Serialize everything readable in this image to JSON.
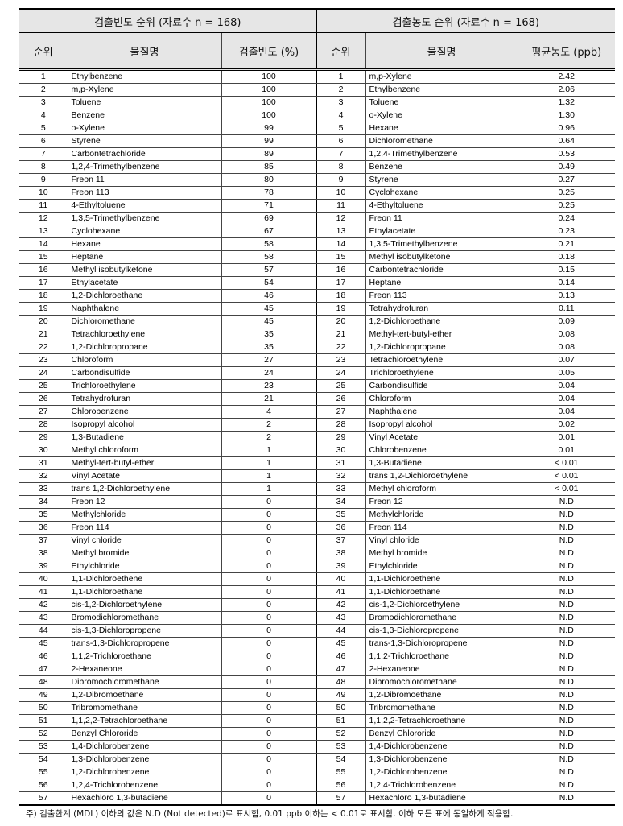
{
  "header": {
    "left_title": "검출빈도 순위 (자료수 n = 168)",
    "right_title": "검출농도 순위 (자료수 n = 168)",
    "col_rank": "순위",
    "col_name": "물질명",
    "col_freq": "검출빈도 (%)",
    "col_rank2": "순위",
    "col_name2": "물질명",
    "col_conc": "평균농도 (ppb)"
  },
  "left_rows": [
    [
      "1",
      "Ethylbenzene",
      "100"
    ],
    [
      "2",
      "m,p-Xylene",
      "100"
    ],
    [
      "3",
      "Toluene",
      "100"
    ],
    [
      "4",
      "Benzene",
      "100"
    ],
    [
      "5",
      "o-Xylene",
      "99"
    ],
    [
      "6",
      "Styrene",
      "99"
    ],
    [
      "7",
      "Carbontetrachloride",
      "89"
    ],
    [
      "8",
      "1,2,4-Trimethylbenzene",
      "85"
    ],
    [
      "9",
      "Freon  11",
      "80"
    ],
    [
      "10",
      "Freon  113",
      "78"
    ],
    [
      "11",
      "4-Ethyltoluene",
      "71"
    ],
    [
      "12",
      "1,3,5-Trimethylbenzene",
      "69"
    ],
    [
      "13",
      "Cyclohexane",
      "67"
    ],
    [
      "14",
      "Hexane",
      "58"
    ],
    [
      "15",
      "Heptane",
      "58"
    ],
    [
      "16",
      "Methyl  isobutylketone",
      "57"
    ],
    [
      "17",
      "Ethylacetate",
      "54"
    ],
    [
      "18",
      "1,2-Dichloroethane",
      "46"
    ],
    [
      "19",
      "Naphthalene",
      "45"
    ],
    [
      "20",
      "Dichloromethane",
      "45"
    ],
    [
      "21",
      "Tetrachloroethylene",
      "35"
    ],
    [
      "22",
      "1,2-Dichloropropane",
      "35"
    ],
    [
      "23",
      "Chloroform",
      "27"
    ],
    [
      "24",
      "Carbondisulfide",
      "24"
    ],
    [
      "25",
      "Trichloroethylene",
      "23"
    ],
    [
      "26",
      "Tetrahydrofuran",
      "21"
    ],
    [
      "27",
      "Chlorobenzene",
      "4"
    ],
    [
      "28",
      "Isopropyl  alcohol",
      "2"
    ],
    [
      "29",
      "1,3-Butadiene",
      "2"
    ],
    [
      "30",
      "Methyl  chloroform",
      "1"
    ],
    [
      "31",
      "Methyl-tert-butyl-ether",
      "1"
    ],
    [
      "32",
      "Vinyl  Acetate",
      "1"
    ],
    [
      "33",
      "trans  1,2-Dichloroethylene",
      "1"
    ],
    [
      "34",
      "Freon  12",
      "0"
    ],
    [
      "35",
      "Methylchloride",
      "0"
    ],
    [
      "36",
      "Freon  114",
      "0"
    ],
    [
      "37",
      "Vinyl  chloride",
      "0"
    ],
    [
      "38",
      "Methyl  bromide",
      "0"
    ],
    [
      "39",
      "Ethylchloride",
      "0"
    ],
    [
      "40",
      "1,1-Dichloroethene",
      "0"
    ],
    [
      "41",
      "1,1-Dichloroethane",
      "0"
    ],
    [
      "42",
      "cis-1,2-Dichloroethylene",
      "0"
    ],
    [
      "43",
      "Bromodichloromethane",
      "0"
    ],
    [
      "44",
      "cis-1,3-Dichloropropene",
      "0"
    ],
    [
      "45",
      "trans-1,3-Dichloropropene",
      "0"
    ],
    [
      "46",
      "1,1,2-Trichloroethane",
      "0"
    ],
    [
      "47",
      "2-Hexaneone",
      "0"
    ],
    [
      "48",
      "Dibromochloromethane",
      "0"
    ],
    [
      "49",
      "1,2-Dibromoethane",
      "0"
    ],
    [
      "50",
      "Tribromomethane",
      "0"
    ],
    [
      "51",
      "1,1,2,2-Tetrachloroethane",
      "0"
    ],
    [
      "52",
      "Benzyl  Chlororide",
      "0"
    ],
    [
      "53",
      "1,4-Dichlorobenzene",
      "0"
    ],
    [
      "54",
      "1,3-Dichlorobenzene",
      "0"
    ],
    [
      "55",
      "1,2-Dichlorobenzene",
      "0"
    ],
    [
      "56",
      "1,2,4-Trichlorobenzene",
      "0"
    ],
    [
      "57",
      "Hexachloro  1,3-butadiene",
      "0"
    ]
  ],
  "right_rows": [
    [
      "1",
      "m,p-Xylene",
      "2.42"
    ],
    [
      "2",
      "Ethylbenzene",
      "2.06"
    ],
    [
      "3",
      "Toluene",
      "1.32"
    ],
    [
      "4",
      "o-Xylene",
      "1.30"
    ],
    [
      "5",
      "Hexane",
      "0.96"
    ],
    [
      "6",
      "Dichloromethane",
      "0.64"
    ],
    [
      "7",
      "1,2,4-Trimethylbenzene",
      "0.53"
    ],
    [
      "8",
      "Benzene",
      "0.49"
    ],
    [
      "9",
      "Styrene",
      "0.27"
    ],
    [
      "10",
      "Cyclohexane",
      "0.25"
    ],
    [
      "11",
      "4-Ethyltoluene",
      "0.25"
    ],
    [
      "12",
      "Freon  11",
      "0.24"
    ],
    [
      "13",
      "Ethylacetate",
      "0.23"
    ],
    [
      "14",
      "1,3,5-Trimethylbenzene",
      "0.21"
    ],
    [
      "15",
      "Methyl  isobutylketone",
      "0.18"
    ],
    [
      "16",
      "Carbontetrachloride",
      "0.15"
    ],
    [
      "17",
      "Heptane",
      "0.14"
    ],
    [
      "18",
      "Freon  113",
      "0.13"
    ],
    [
      "19",
      "Tetrahydrofuran",
      "0.11"
    ],
    [
      "20",
      "1,2-Dichloroethane",
      "0.09"
    ],
    [
      "21",
      "Methyl-tert-butyl-ether",
      "0.08"
    ],
    [
      "22",
      "1,2-Dichloropropane",
      "0.08"
    ],
    [
      "23",
      "Tetrachloroethylene",
      "0.07"
    ],
    [
      "24",
      "Trichloroethylene",
      "0.05"
    ],
    [
      "25",
      "Carbondisulfide",
      "0.04"
    ],
    [
      "26",
      "Chloroform",
      "0.04"
    ],
    [
      "27",
      "Naphthalene",
      "0.04"
    ],
    [
      "28",
      "Isopropyl  alcohol",
      "0.02"
    ],
    [
      "29",
      "Vinyl  Acetate",
      "0.01"
    ],
    [
      "30",
      "Chlorobenzene",
      "0.01"
    ],
    [
      "31",
      "1,3-Butadiene",
      "<  0.01"
    ],
    [
      "32",
      "trans  1,2-Dichloroethylene",
      "<  0.01"
    ],
    [
      "33",
      "Methyl  chloroform",
      "<  0.01"
    ],
    [
      "34",
      "Freon  12",
      "N.D"
    ],
    [
      "35",
      "Methylchloride",
      "N.D"
    ],
    [
      "36",
      "Freon  114",
      "N.D"
    ],
    [
      "37",
      "Vinyl  chloride",
      "N.D"
    ],
    [
      "38",
      "Methyl  bromide",
      "N.D"
    ],
    [
      "39",
      "Ethylchloride",
      "N.D"
    ],
    [
      "40",
      "1,1-Dichloroethene",
      "N.D"
    ],
    [
      "41",
      "1,1-Dichloroethane",
      "N.D"
    ],
    [
      "42",
      "cis-1,2-Dichloroethylene",
      "N.D"
    ],
    [
      "43",
      "Bromodichloromethane",
      "N.D"
    ],
    [
      "44",
      "cis-1,3-Dichloropropene",
      "N.D"
    ],
    [
      "45",
      "trans-1,3-Dichloropropene",
      "N.D"
    ],
    [
      "46",
      "1,1,2-Trichloroethane",
      "N.D"
    ],
    [
      "47",
      "2-Hexaneone",
      "N.D"
    ],
    [
      "48",
      "Dibromochloromethane",
      "N.D"
    ],
    [
      "49",
      "1,2-Dibromoethane",
      "N.D"
    ],
    [
      "50",
      "Tribromomethane",
      "N.D"
    ],
    [
      "51",
      "1,1,2,2-Tetrachloroethane",
      "N.D"
    ],
    [
      "52",
      "Benzyl  Chlororide",
      "N.D"
    ],
    [
      "53",
      "1,4-Dichlorobenzene",
      "N.D"
    ],
    [
      "54",
      "1,3-Dichlorobenzene",
      "N.D"
    ],
    [
      "55",
      "1,2-Dichlorobenzene",
      "N.D"
    ],
    [
      "56",
      "1,2,4-Trichlorobenzene",
      "N.D"
    ],
    [
      "57",
      "Hexachloro  1,3-butadiene",
      "N.D"
    ]
  ],
  "note": "주) 검출한계 (MDL) 이하의 값은 N.D (Not detected)로 표시함, 0.01 ppb 이하는 < 0.01로 표시함. 이하 모든 표에 동일하게 적용함."
}
